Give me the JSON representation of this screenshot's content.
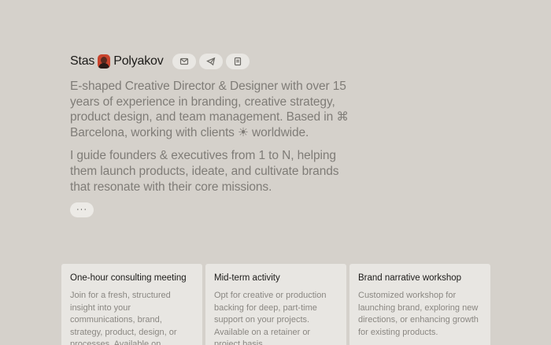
{
  "profile": {
    "first_name": "Stas",
    "last_name": "Polyakov"
  },
  "contacts": [
    {
      "icon": "mail-icon"
    },
    {
      "icon": "telegram-icon"
    },
    {
      "icon": "document-icon"
    }
  ],
  "bio": {
    "paragraph_1": "E-shaped Creative Director & Designer with over 15 years of experience in branding, creative strategy, product design, and team management. Based in ⌘ Barcelona, working with clients ☀ worldwide.",
    "paragraph_2": "I guide founders & executives from 1 to N, helping them launch products, ideate, and cultivate brands that resonate with their core missions."
  },
  "more_button": {
    "label": "···"
  },
  "services": [
    {
      "title": "One-hour consulting meeting",
      "description": "Join for a fresh, structured insight into your communications, brand, strategy, product, design, or processes. Available on"
    },
    {
      "title": "Mid-term activity",
      "description": "Opt for creative or production backing for deep, part-time support on your projects. Available on a retainer or project basis."
    },
    {
      "title": "Brand narrative workshop",
      "description": "Customized workshop for launching brand, exploring new directions, or enhancing growth for existing products."
    }
  ]
}
